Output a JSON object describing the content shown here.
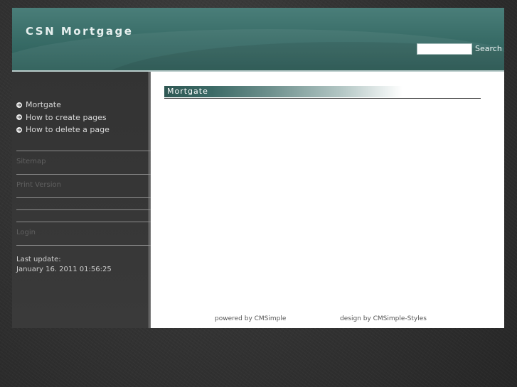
{
  "header": {
    "title": "CSN Mortgage",
    "search_placeholder": "",
    "search_label": "Search"
  },
  "sidebar": {
    "nav_items": [
      {
        "label": "Mortgate"
      },
      {
        "label": "How to create pages"
      },
      {
        "label": "How to delete a page"
      }
    ],
    "links": {
      "sitemap": "Sitemap",
      "print_version": "Print Version",
      "login": "Login"
    },
    "last_update_label": "Last update:",
    "last_update_value": "January 16. 2011 01:56:25"
  },
  "content": {
    "title": "Mortgate"
  },
  "footer": {
    "powered_by": "powered by CMSimple",
    "design_by": "design by CMSimple-Styles"
  },
  "colors": {
    "header_teal": "#3a6e69",
    "sidebar_dark": "#333333"
  }
}
